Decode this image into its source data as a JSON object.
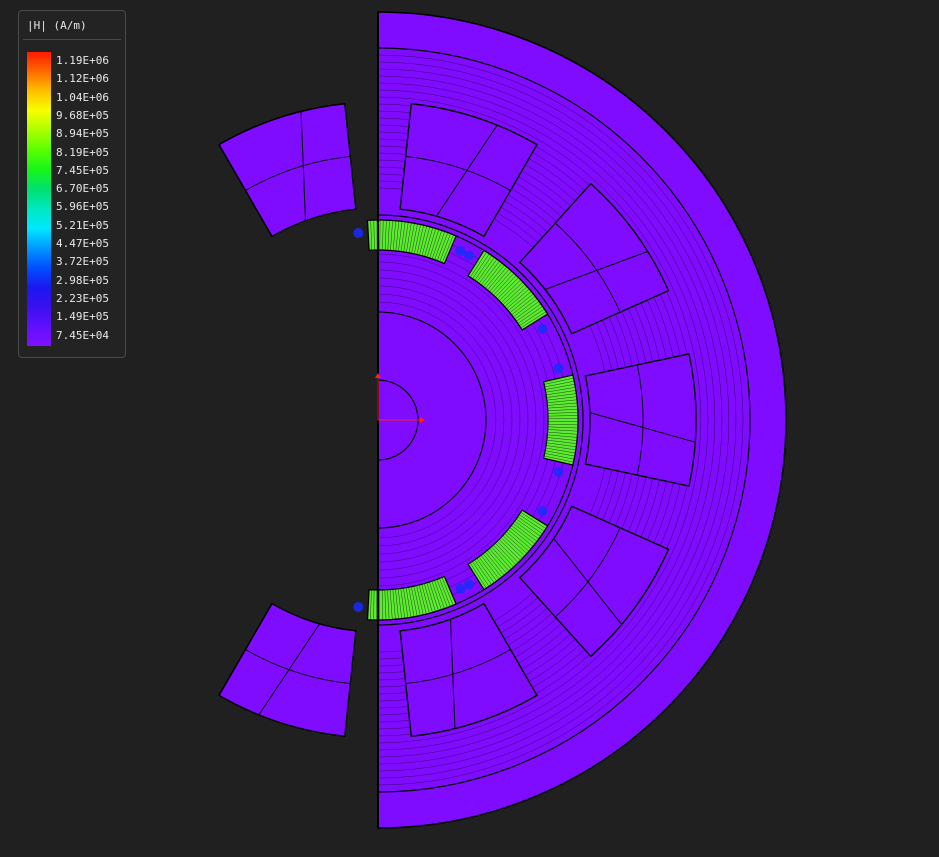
{
  "legend": {
    "title": "|H| (A/m)",
    "ticks": [
      "1.19E+06",
      "1.12E+06",
      "1.04E+06",
      "9.68E+05",
      "8.94E+05",
      "8.19E+05",
      "7.45E+05",
      "6.70E+05",
      "5.96E+05",
      "5.21E+05",
      "4.47E+05",
      "3.72E+05",
      "2.98E+05",
      "2.23E+05",
      "1.49E+05",
      "7.45E+04"
    ],
    "colormap": [
      "#ff1a00",
      "#ff6a00",
      "#ffc000",
      "#f7ff00",
      "#aaff00",
      "#5aff00",
      "#17f51a",
      "#00e070",
      "#00e8c0",
      "#00e8ff",
      "#0098ff",
      "#0050ff",
      "#1a18f0",
      "#3a10f0",
      "#6010ff",
      "#8010ff"
    ]
  },
  "colors": {
    "background": "#202020",
    "core": "#7f0cff",
    "magnet": "#5cea32",
    "outline": "#000000",
    "hotspot": "#1a2cff",
    "axis": "#ff2020"
  }
}
